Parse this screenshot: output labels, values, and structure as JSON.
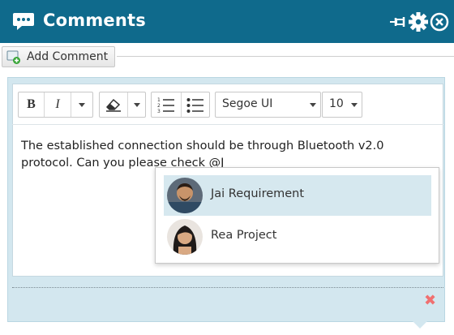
{
  "panel": {
    "title": "Comments",
    "title_icon": "speech-bubble-icon",
    "header_icons": [
      "pin-icon",
      "gear-icon",
      "close-circle-icon"
    ]
  },
  "add_comment": {
    "label": "Add Comment",
    "icon": "add-comment-icon"
  },
  "toolbar": {
    "bold": "B",
    "italic": "I",
    "font_family": "Segoe UI",
    "font_size": "10"
  },
  "editor": {
    "text": "The established connection should be through Bluetooth v2.0 protocol. Can you please check @J"
  },
  "mention_suggestions": [
    {
      "name": "Jai Requirement",
      "selected": true
    },
    {
      "name": "Rea Project",
      "selected": false
    }
  ],
  "colors": {
    "header": "#0f6a8c",
    "panel": "#d3e7ef",
    "selected": "#d6e8ef",
    "close": "#f07070"
  }
}
